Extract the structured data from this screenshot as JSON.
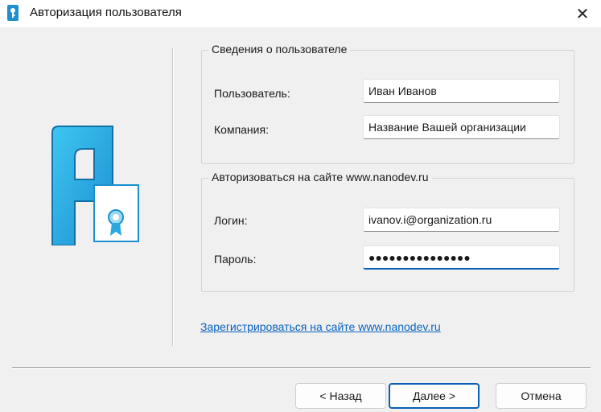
{
  "window": {
    "title": "Авторизация пользователя",
    "close_glyph": "✕"
  },
  "user_info": {
    "legend": "Сведения о пользователе",
    "user_label": "Пользователь:",
    "user_value": "Иван Иванов",
    "company_label": "Компания:",
    "company_value": "Название Вашей организации"
  },
  "site_auth": {
    "legend": "Авторизоваться на сайте www.nanodev.ru",
    "login_label": "Логин:",
    "login_value": "ivanov.i@organization.ru",
    "password_label": "Пароль:",
    "password_value": "●●●●●●●●●●●●●●●"
  },
  "register_link": "Зарегистрироваться на сайте www.nanodev.ru",
  "buttons": {
    "back": "< Назад",
    "next": "Далее >",
    "cancel": "Отмена"
  },
  "icons": {
    "app": "app-key-icon",
    "logo": "nanocad-certificate-logo",
    "close": "close-icon"
  },
  "colors": {
    "accent": "#0a5fb4",
    "link": "#0b62c0",
    "logo_blue": "#2aa8e0"
  }
}
